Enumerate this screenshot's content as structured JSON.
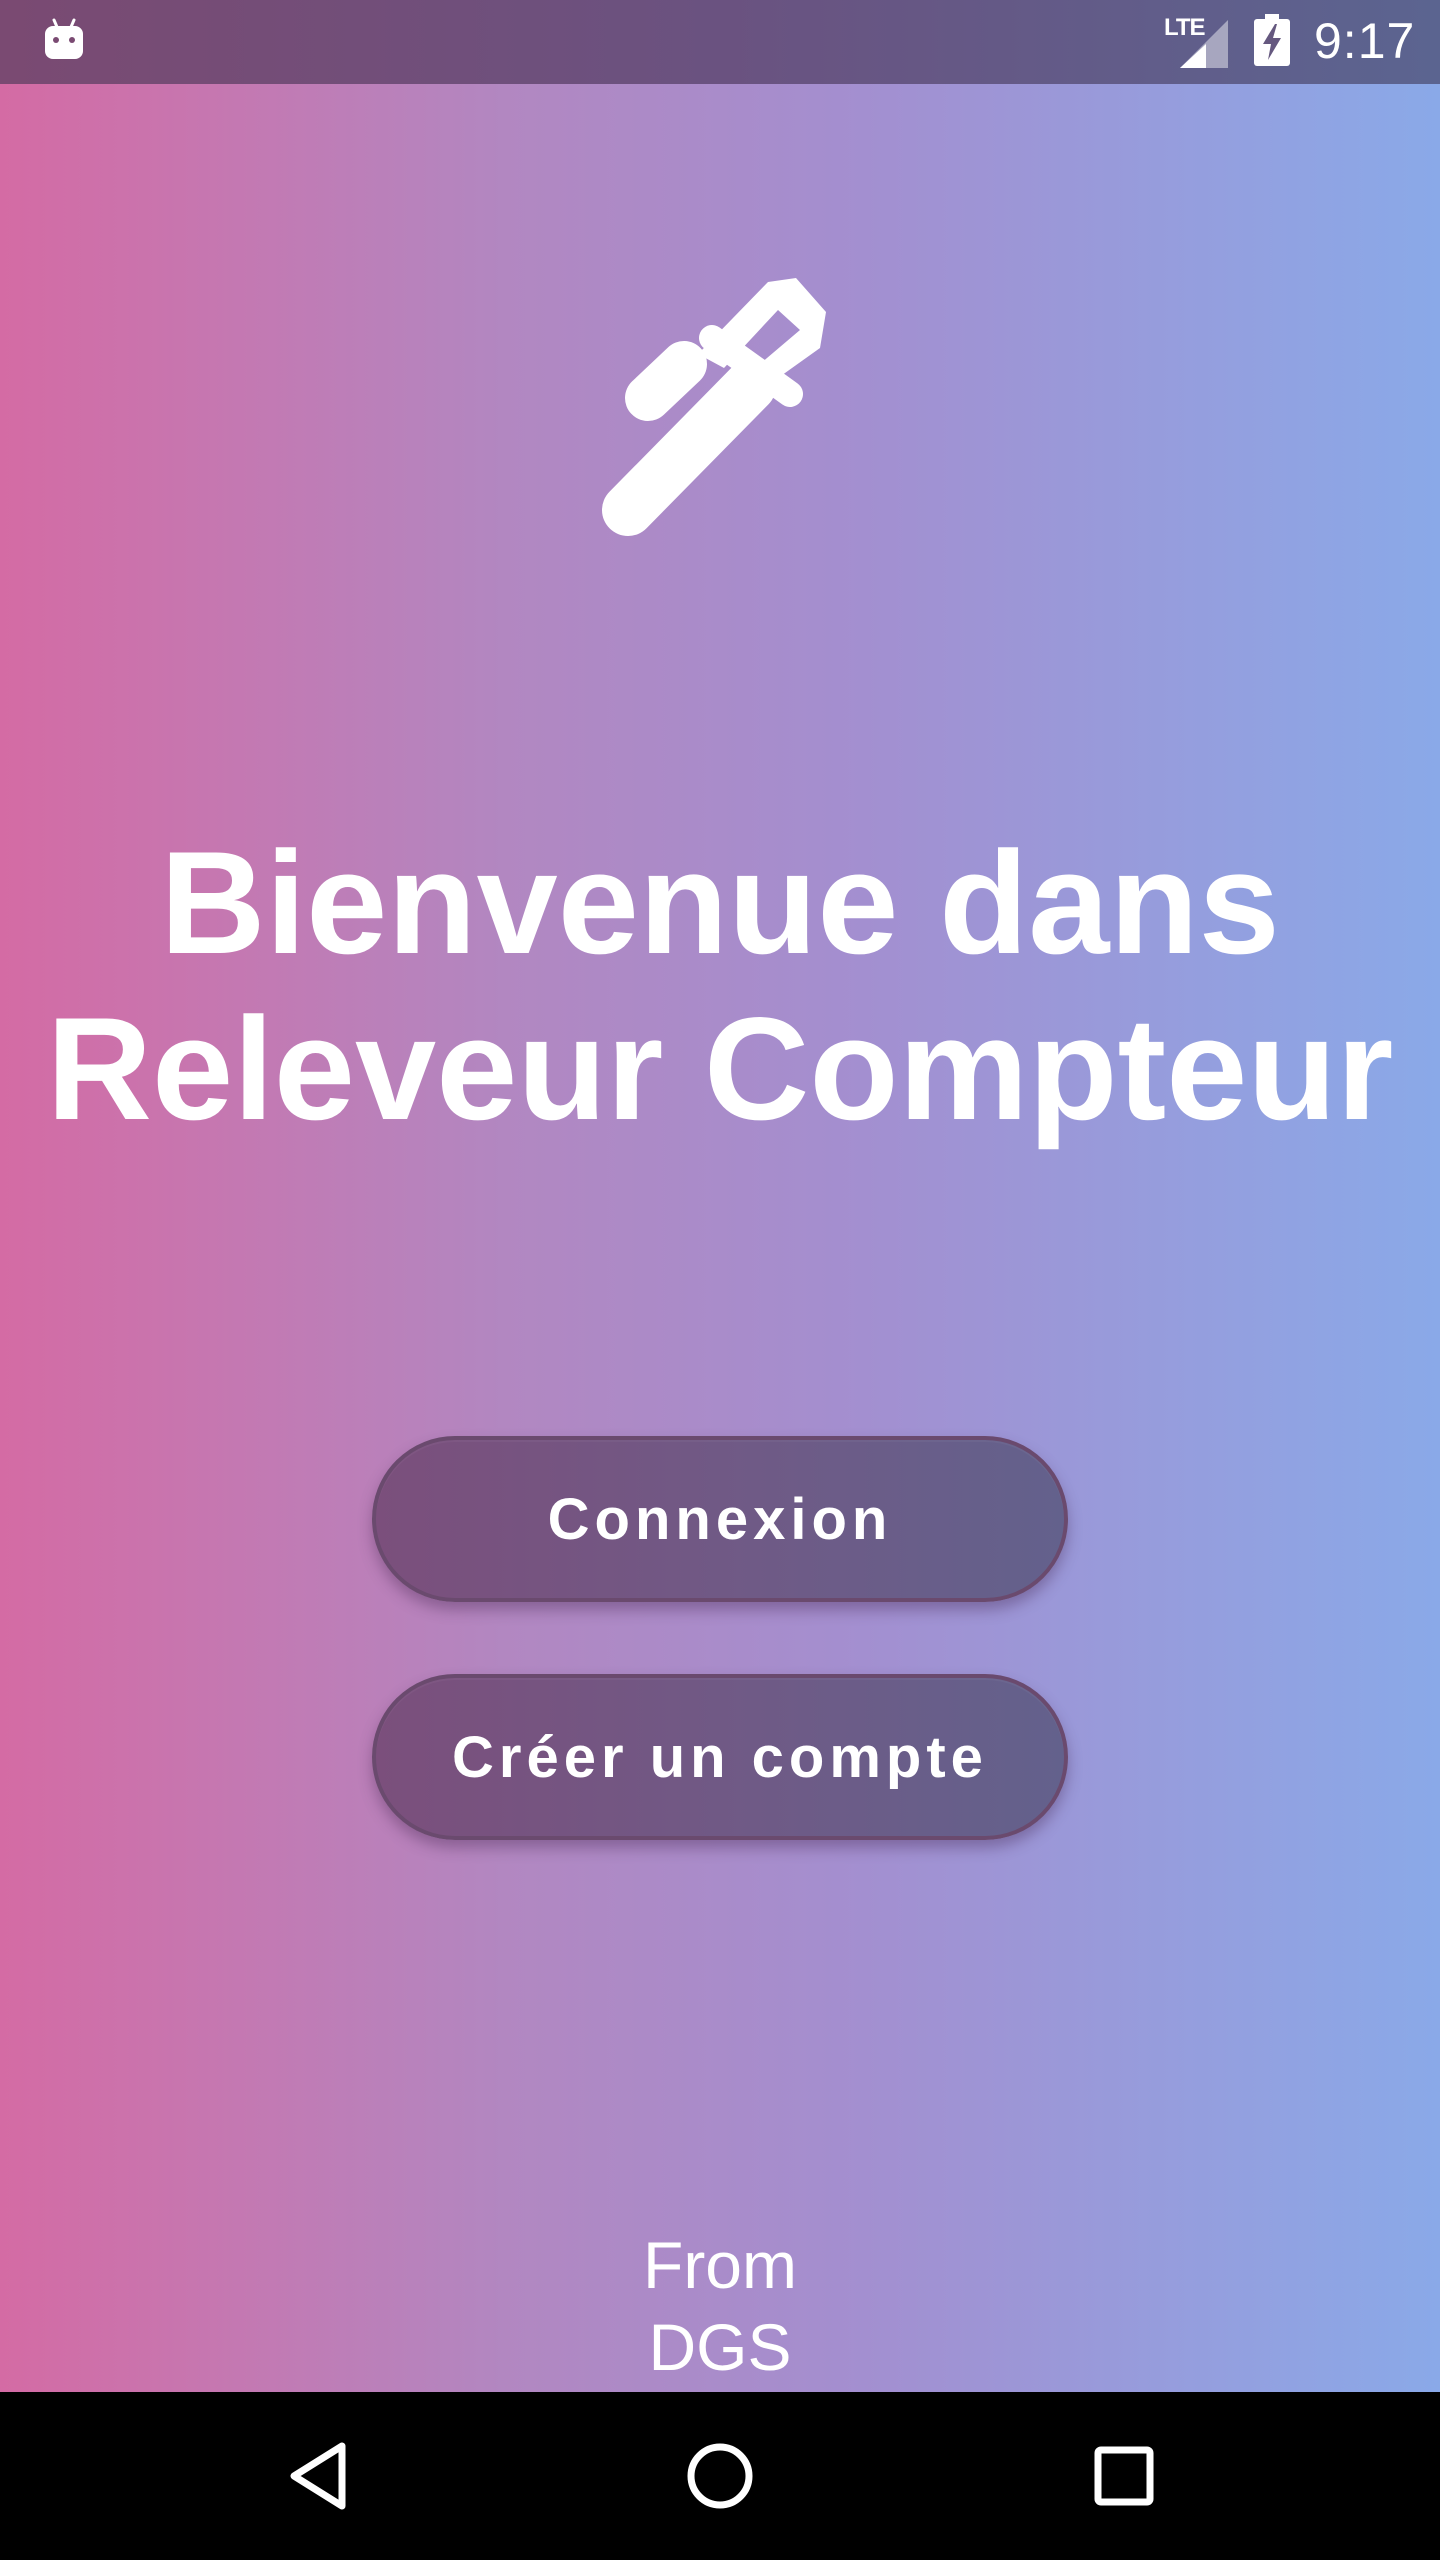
{
  "status_bar": {
    "network_label": "LTE",
    "time": "9:17",
    "left_icon": "android-notification-icon",
    "signal_icon": "signal-icon",
    "battery_icon": "battery-charging-icon"
  },
  "app": {
    "logo_icon": "wrench-icon",
    "title_line1": "Bienvenue dans",
    "title_line2": "Releveur Compteur",
    "buttons": {
      "login_label": "Connexion",
      "register_label": "Créer un compte"
    },
    "footer_line1": "From",
    "footer_line2": "DGS"
  },
  "nav_bar": {
    "back_icon": "back-icon",
    "home_icon": "home-icon",
    "recents_icon": "recents-icon"
  },
  "colors": {
    "gradient_left": "#d46ba4",
    "gradient_right": "#8aa9e8",
    "button_fill": "#735583",
    "text": "#ffffff",
    "nav_bar": "#000000"
  }
}
